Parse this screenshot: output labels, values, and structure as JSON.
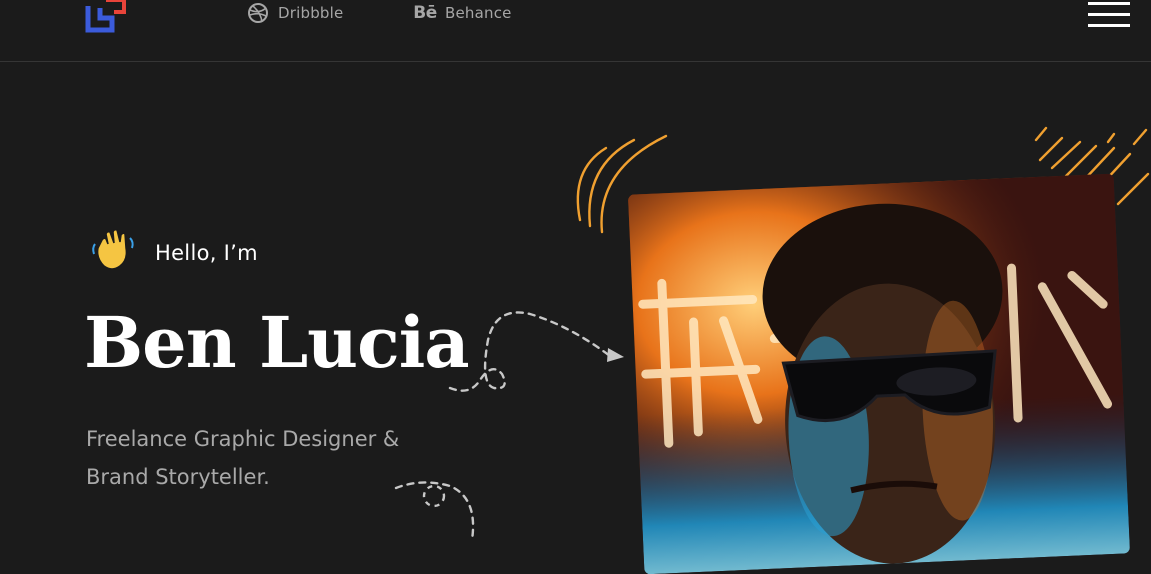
{
  "header": {
    "logo_name": "brand-logo",
    "nav": [
      {
        "label": "Dribbble",
        "icon": "dribbble-icon"
      },
      {
        "label": "Behance",
        "icon": "behance-icon",
        "icon_glyph": "Bē"
      }
    ],
    "menu_icon": "hamburger-menu-icon"
  },
  "hero": {
    "wave_icon": "waving-hand-emoji",
    "greeting": "Hello, I’m",
    "name": "Ben Lucia",
    "tagline_lines": [
      "Freelance Graphic Designer &",
      "Brand Storyteller."
    ]
  },
  "colors": {
    "background": "#1b1b1b",
    "text_primary": "#ffffff",
    "text_muted": "#a9a9a9",
    "nav_text": "#a6a6a6",
    "accent_orange": "#f0a030",
    "logo_blue": "#3b5bdb",
    "logo_red": "#e8443a",
    "divider": "#353535"
  }
}
